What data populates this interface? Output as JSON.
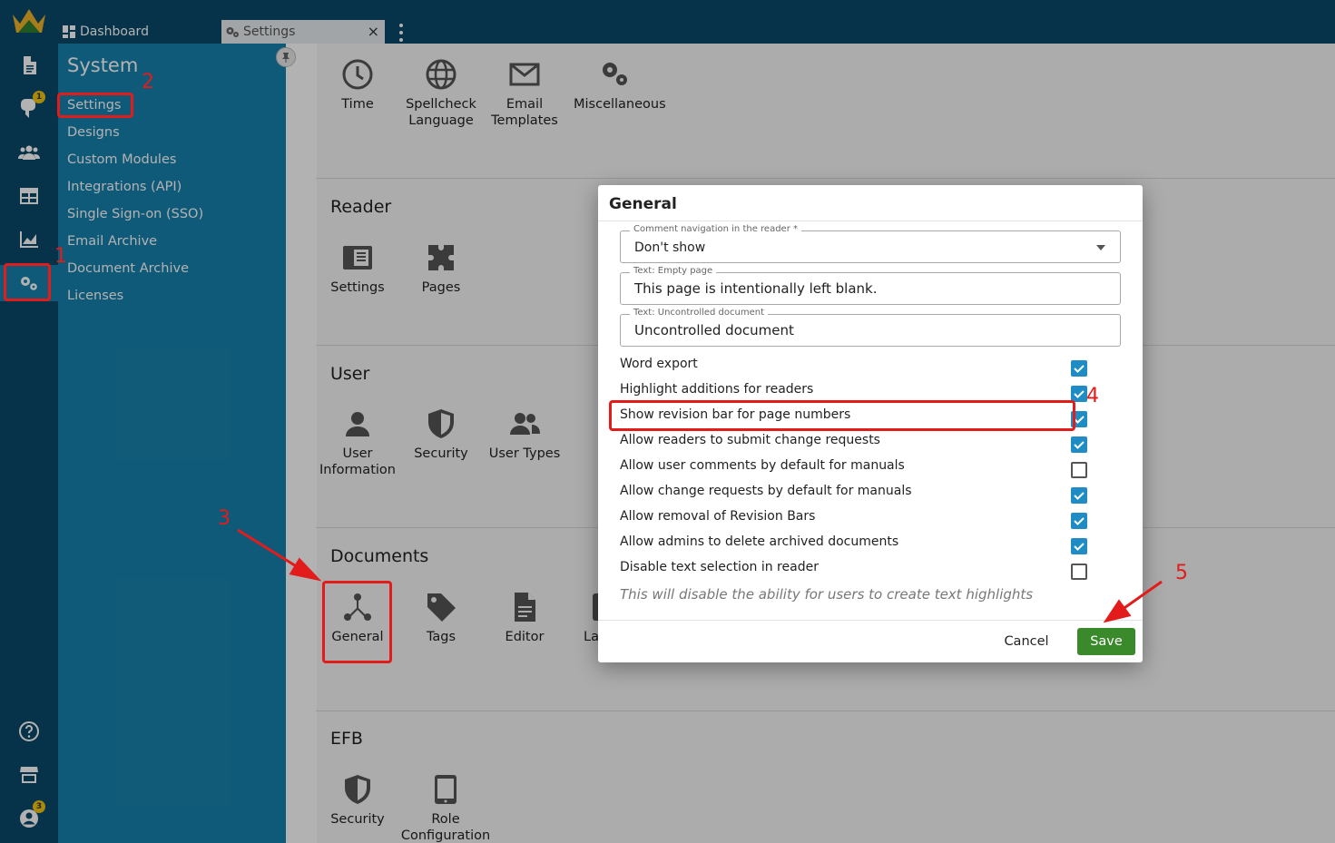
{
  "tabs": {
    "dashboard": "Dashboard",
    "settings": "Settings",
    "close": "×"
  },
  "sidebar": {
    "heading": "System",
    "items": [
      "Settings",
      "Designs",
      "Custom Modules",
      "Integrations (API)",
      "Single Sign-on (SSO)",
      "Email Archive",
      "Document Archive",
      "Licenses"
    ]
  },
  "rail": {
    "notifications_badge": "1",
    "user_badge": "3",
    "icons": [
      "document-icon",
      "comment-icon",
      "users-icon",
      "table-icon",
      "chart-icon",
      "gears-icon",
      "help-icon",
      "store-icon",
      "user-circle-icon"
    ]
  },
  "top_tiles": [
    "Time",
    "Spellcheck Language",
    "Email Templates",
    "Miscellaneous"
  ],
  "sections": {
    "reader": {
      "title": "Reader",
      "tiles": [
        "Settings",
        "Pages"
      ]
    },
    "user": {
      "title": "User",
      "tiles": [
        "User Information",
        "Security",
        "User Types"
      ]
    },
    "documents": {
      "title": "Documents",
      "tiles": [
        "General",
        "Tags",
        "Editor",
        "La"
      ]
    },
    "efb": {
      "title": "EFB",
      "tiles": [
        "Security",
        "Role Configuration"
      ]
    }
  },
  "dialog": {
    "title": "General",
    "fields": [
      {
        "label": "Comment navigation in the reader *",
        "value": "Don't show"
      },
      {
        "label": "Text: Empty page",
        "value": "This page is intentionally left blank."
      },
      {
        "label": "Text: Uncontrolled document",
        "value": "Uncontrolled document"
      }
    ],
    "options": [
      {
        "label": "Word export",
        "checked": true
      },
      {
        "label": "Highlight additions for readers",
        "checked": true
      },
      {
        "label": "Show revision bar for page numbers",
        "checked": true
      },
      {
        "label": "Allow readers to submit change requests",
        "checked": true
      },
      {
        "label": "Allow user comments by default for manuals",
        "checked": false
      },
      {
        "label": "Allow change requests by default for manuals",
        "checked": true
      },
      {
        "label": "Allow removal of Revision Bars",
        "checked": true
      },
      {
        "label": "Allow admins to delete archived documents",
        "checked": true
      },
      {
        "label": "Disable text selection in reader",
        "checked": false
      }
    ],
    "hint": "This will disable the ability for users to create text highlights",
    "cancel": "Cancel",
    "save": "Save"
  },
  "annotations": [
    "1",
    "2",
    "3",
    "4",
    "5"
  ],
  "colors": {
    "rail": "#0b4a6b",
    "sidebar": "#1882ae",
    "checkbox": "#1f8dc4",
    "save": "#3a8a2c",
    "annotation": "#e21b1b"
  }
}
